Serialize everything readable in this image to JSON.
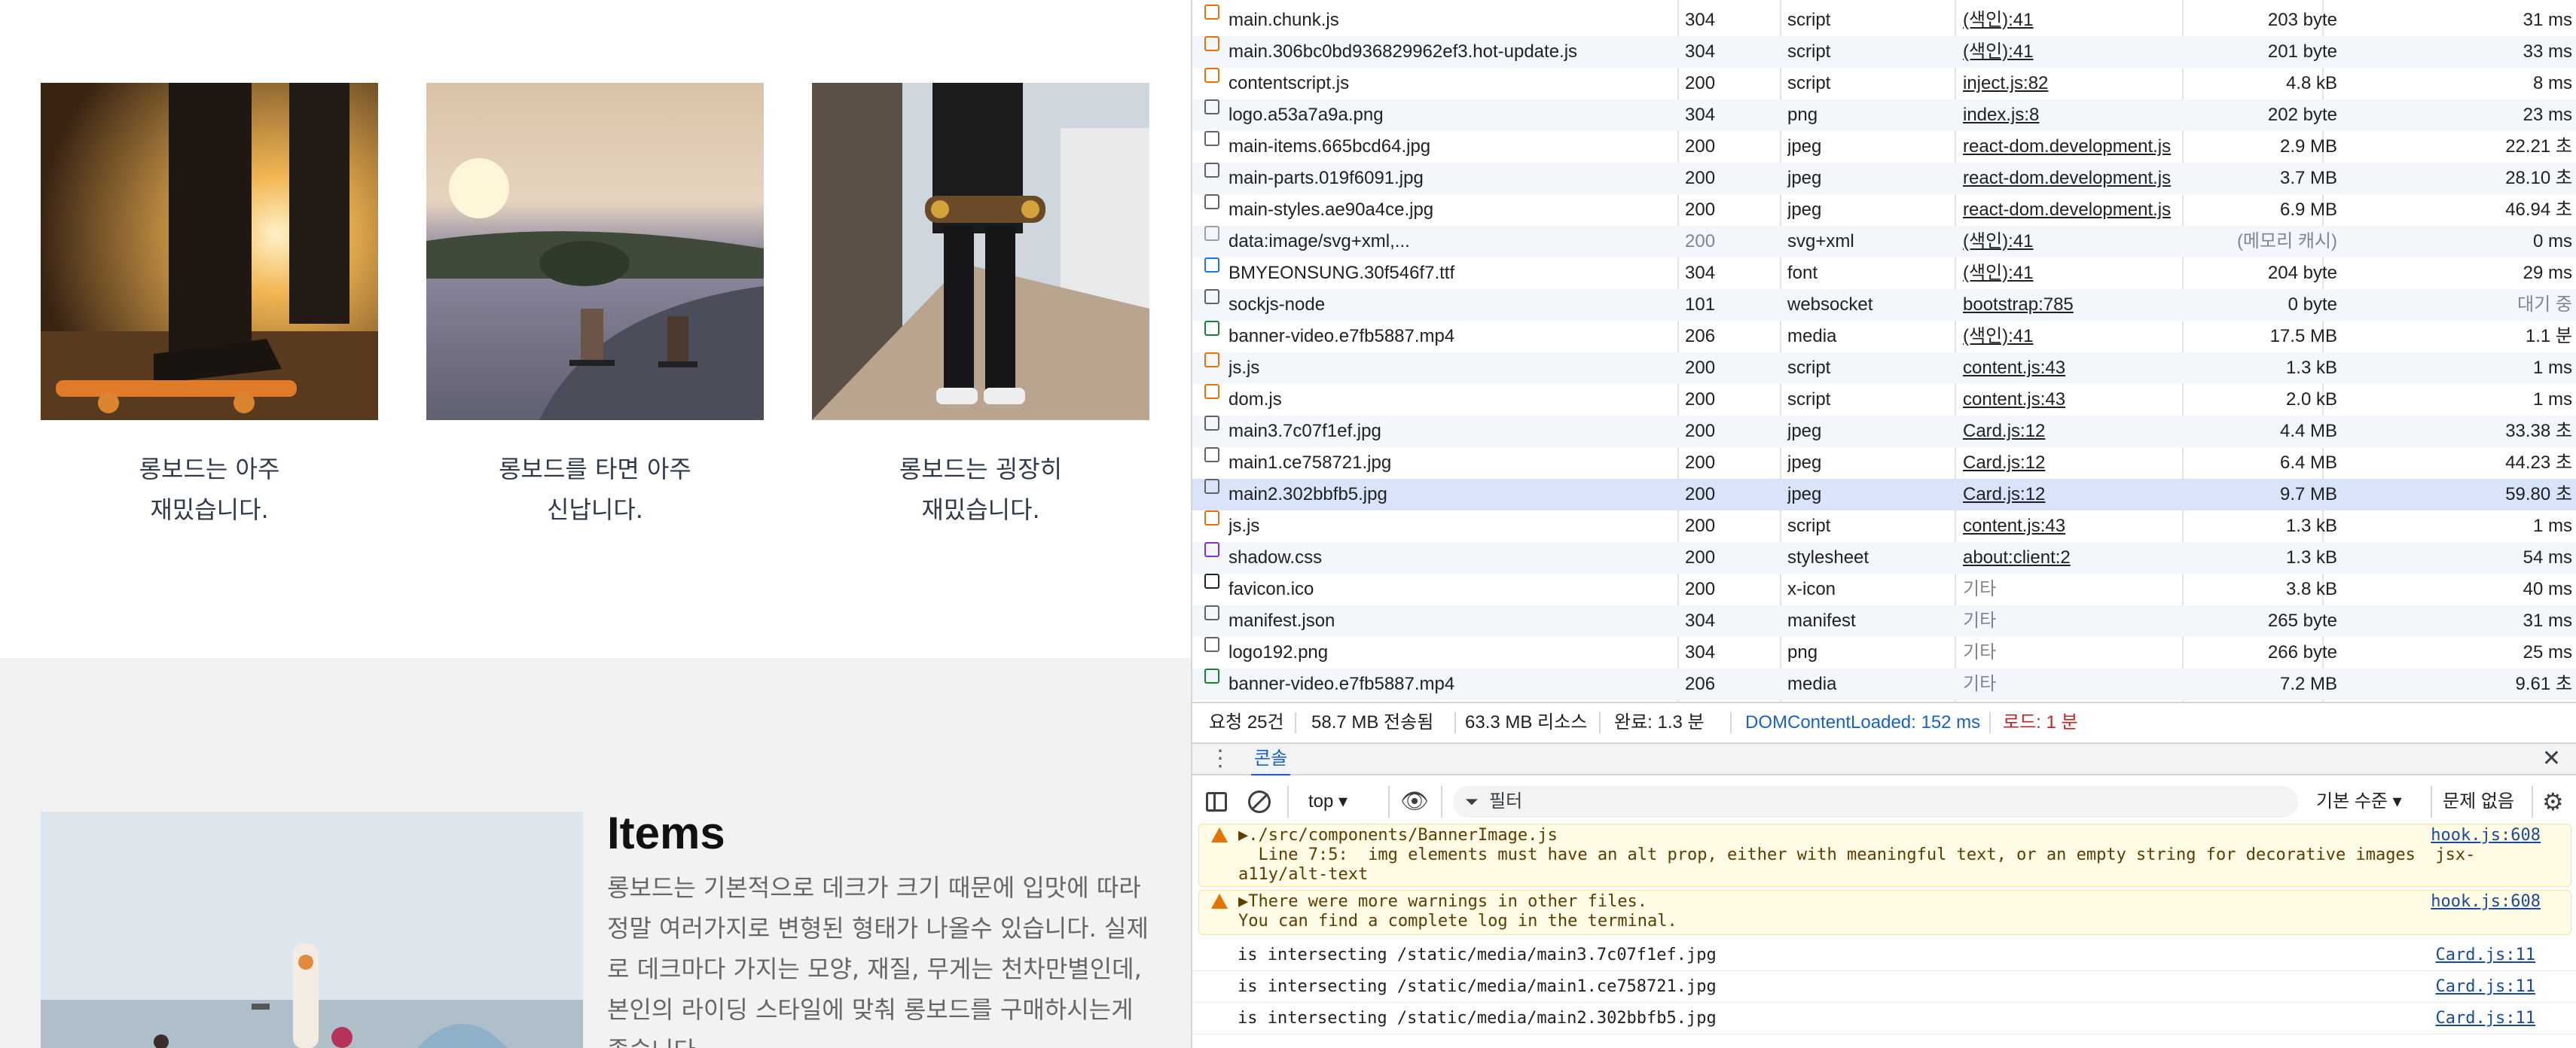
{
  "page": {
    "cards": [
      {
        "text": "롱보드는 아주\n재밌습니다."
      },
      {
        "text": "롱보드를 타면 아주\n신납니다."
      },
      {
        "text": "롱보드는 굉장히\n재밌습니다."
      }
    ],
    "items_title": "Items",
    "items_desc": "롱보드는 기본적으로 데크가 크기 때문에 입맛에 따라 정말 여러가지로 변형된 형태가 나올수 있습니다. 실제로 데크마다 가지는 모양, 재질, 무게는 천차만별인데, 본인의 라이딩 스타일에 맞춰 롱보드를 구매하시는게 좋습니다."
  },
  "network": {
    "rows": [
      {
        "name": "main.chunk.js",
        "icon": "script-icon",
        "status": "304",
        "type": "script",
        "initiator": "(색인):41",
        "size": "203 byte",
        "time": "31 ms"
      },
      {
        "name": "main.306bc0bd936829962ef3.hot-update.js",
        "icon": "script-icon",
        "status": "304",
        "type": "script",
        "initiator": "(색인):41",
        "size": "201 byte",
        "time": "33 ms"
      },
      {
        "name": "contentscript.js",
        "icon": "script-icon",
        "status": "200",
        "type": "script",
        "initiator": "inject.js:82",
        "size": "4.8 kB",
        "time": "8 ms"
      },
      {
        "name": "logo.a53a7a9a.png",
        "icon": "image-icon",
        "status": "304",
        "type": "png",
        "initiator": "index.js:8",
        "size": "202 byte",
        "time": "23 ms"
      },
      {
        "name": "main-items.665bcd64.jpg",
        "icon": "image-icon",
        "status": "200",
        "type": "jpeg",
        "initiator": "react-dom.development.js",
        "size": "2.9 MB",
        "time": "22.21 초"
      },
      {
        "name": "main-parts.019f6091.jpg",
        "icon": "image-icon",
        "status": "200",
        "type": "jpeg",
        "initiator": "react-dom.development.js",
        "size": "3.7 MB",
        "time": "28.10 초"
      },
      {
        "name": "main-styles.ae90a4ce.jpg",
        "icon": "image-icon",
        "status": "200",
        "type": "jpeg",
        "initiator": "react-dom.development.js",
        "size": "6.9 MB",
        "time": "46.94 초"
      },
      {
        "name": "data:image/svg+xml,...",
        "icon": "svg-icon",
        "status": "200",
        "status_gray": true,
        "type": "svg+xml",
        "initiator": "(색인):41",
        "size": "(메모리 캐시)",
        "size_gray": true,
        "time": "0 ms"
      },
      {
        "name": "BMYEONSUNG.30f546f7.ttf",
        "icon": "font-icon",
        "status": "304",
        "type": "font",
        "initiator": "(색인):41",
        "size": "204 byte",
        "time": "29 ms"
      },
      {
        "name": "sockjs-node",
        "icon": "websocket-icon",
        "status": "101",
        "type": "websocket",
        "initiator": "bootstrap:785",
        "size": "0 byte",
        "time": "대기 중",
        "time_gray": true
      },
      {
        "name": "banner-video.e7fb5887.mp4",
        "icon": "media-icon",
        "status": "206",
        "type": "media",
        "initiator": "(색인):41",
        "size": "17.5 MB",
        "time": "1.1 분"
      },
      {
        "name": "js.js",
        "icon": "script-icon",
        "status": "200",
        "type": "script",
        "initiator": "content.js:43",
        "size": "1.3 kB",
        "time": "1 ms"
      },
      {
        "name": "dom.js",
        "icon": "script-icon",
        "status": "200",
        "type": "script",
        "initiator": "content.js:43",
        "size": "2.0 kB",
        "time": "1 ms"
      },
      {
        "name": "main3.7c07f1ef.jpg",
        "icon": "image-icon",
        "status": "200",
        "type": "jpeg",
        "initiator": "Card.js:12",
        "size": "4.4 MB",
        "time": "33.38 초"
      },
      {
        "name": "main1.ce758721.jpg",
        "icon": "image-icon",
        "status": "200",
        "type": "jpeg",
        "initiator": "Card.js:12",
        "size": "6.4 MB",
        "time": "44.23 초"
      },
      {
        "name": "main2.302bbfb5.jpg",
        "icon": "image-icon",
        "status": "200",
        "type": "jpeg",
        "initiator": "Card.js:12",
        "size": "9.7 MB",
        "time": "59.80 초",
        "selected": true
      },
      {
        "name": "js.js",
        "icon": "script-icon",
        "status": "200",
        "type": "script",
        "initiator": "content.js:43",
        "size": "1.3 kB",
        "time": "1 ms"
      },
      {
        "name": "shadow.css",
        "icon": "stylesheet-icon",
        "status": "200",
        "type": "stylesheet",
        "initiator": "about:client:2",
        "size": "1.3 kB",
        "time": "54 ms"
      },
      {
        "name": "favicon.ico",
        "icon": "favicon-icon",
        "status": "200",
        "type": "x-icon",
        "initiator": "기타",
        "initiator_plain": true,
        "size": "3.8 kB",
        "time": "40 ms"
      },
      {
        "name": "manifest.json",
        "icon": "document-icon",
        "status": "304",
        "type": "manifest",
        "initiator": "기타",
        "initiator_plain": true,
        "size": "265 byte",
        "time": "31 ms"
      },
      {
        "name": "logo192.png",
        "icon": "image-icon",
        "status": "304",
        "type": "png",
        "initiator": "기타",
        "initiator_plain": true,
        "size": "266 byte",
        "time": "25 ms"
      },
      {
        "name": "banner-video.e7fb5887.mp4",
        "icon": "media-icon",
        "status": "206",
        "type": "media",
        "initiator": "기타",
        "initiator_plain": true,
        "size": "7.2 MB",
        "time": "9.61 초"
      }
    ],
    "summary": {
      "requests": "요청 25건",
      "transferred": "58.7 MB 전송됨",
      "resources": "63.3 MB 리소스",
      "finish": "완료: 1.3 분",
      "dcl": "DOMContentLoaded: 152 ms",
      "load": "로드: 1 분"
    }
  },
  "drawer": {
    "tab_label": "콘솔",
    "context": "top",
    "filter_placeholder": "필터",
    "levels_label": "기본 수준",
    "issues_label": "문제 없음"
  },
  "console": {
    "warnings": [
      {
        "text": "▶./src/components/BannerImage.js\n  Line 7:5:  img elements must have an alt prop, either with meaningful text, or an empty string for decorative images  jsx-\na11y/alt-text",
        "source": "hook.js:608"
      },
      {
        "text": "▶There were more warnings in other files.\nYou can find a complete log in the terminal.",
        "source": "hook.js:608"
      }
    ],
    "logs": [
      {
        "text": "is intersecting /static/media/main3.7c07f1ef.jpg",
        "source": "Card.js:11"
      },
      {
        "text": "is intersecting /static/media/main1.ce758721.jpg",
        "source": "Card.js:11"
      },
      {
        "text": "is intersecting /static/media/main2.302bbfb5.jpg",
        "source": "Card.js:11"
      }
    ]
  },
  "colors": {
    "selected_row": "#d9e4fb",
    "dcl_blue": "#1a5fd0",
    "load_red": "#c5221f",
    "warning_bg": "#fffbe5",
    "link_blue": "#1a4a9c"
  }
}
